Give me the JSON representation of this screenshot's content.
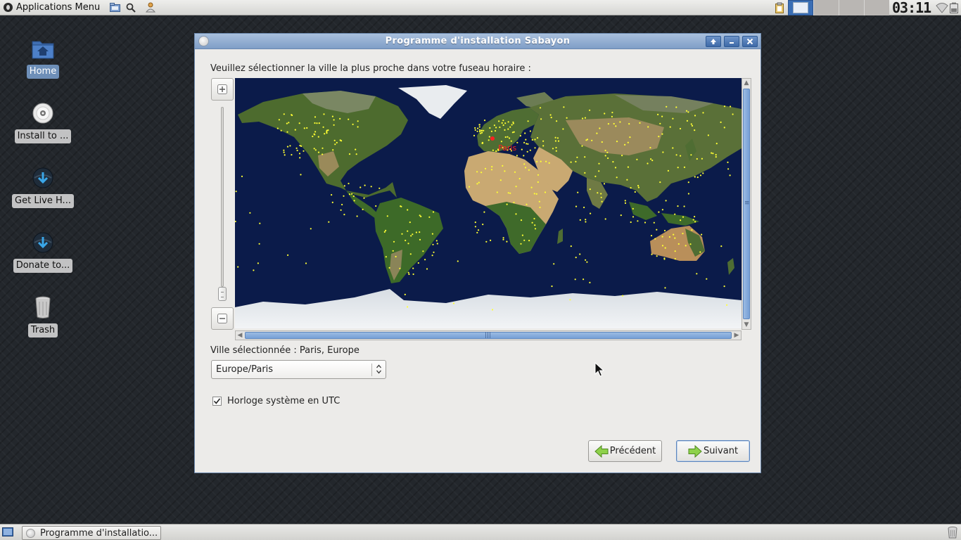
{
  "top_panel": {
    "apps_menu_label": "Applications Menu",
    "launchers": [
      "file-manager-icon",
      "search-icon",
      "user-icon"
    ],
    "clock_text": "03:11"
  },
  "desktop_icons": [
    {
      "label": "Home",
      "icon": "home-folder-icon",
      "selected": true
    },
    {
      "label": "Install to ...",
      "icon": "disc-icon",
      "selected": false
    },
    {
      "label": "Get Live H...",
      "icon": "download-icon",
      "selected": false
    },
    {
      "label": "Donate to...",
      "icon": "download-icon",
      "selected": false
    },
    {
      "label": "Trash",
      "icon": "trash-icon",
      "selected": false
    }
  ],
  "window": {
    "title": "Programme d'installation Sabayon",
    "prompt": "Veuillez sélectionner la ville la plus proche dans votre fuseau horaire :",
    "map_selected_label": "Paris",
    "selected_city_text": "Ville sélectionnée : Paris, Europe",
    "timezone_combo_value": "Europe/Paris",
    "utc_checkbox_label": "Horloge système en UTC",
    "utc_checked": true,
    "prev_button_label": "Précédent",
    "next_button_label": "Suivant"
  },
  "taskbar": {
    "task_label": "Programme d'installatio..."
  },
  "colors": {
    "title_bar": "#8fabd2",
    "ocean": "#0b1b4a",
    "land": "#4a6a2c",
    "desert": "#c9a972",
    "ice": "#e9ecef",
    "city_dot": "#ffff33",
    "selected_city": "#ff2222"
  }
}
